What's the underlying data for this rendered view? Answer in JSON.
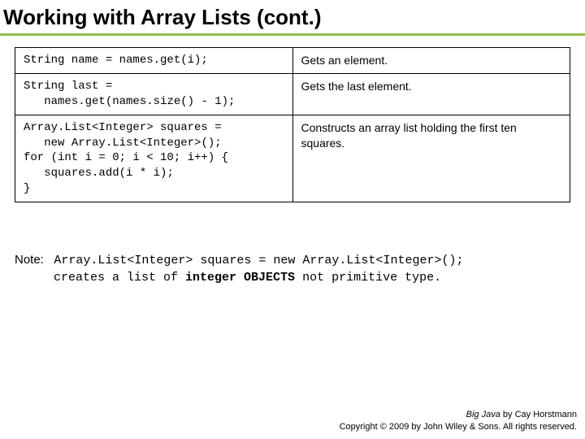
{
  "title": "Working with Array Lists (cont.)",
  "rows": [
    {
      "code": "String name = names.get(i);",
      "desc": "Gets an element."
    },
    {
      "code": "String last =\n   names.get(names.size() - 1);",
      "desc": "Gets the last element."
    },
    {
      "code": "Array.List<Integer> squares =\n   new Array.List<Integer>();\nfor (int i = 0; i < 10; i++) {\n   squares.add(i * i);\n}",
      "desc": "Constructs an array list holding the first ten squares."
    }
  ],
  "note": {
    "label": "Note:",
    "code1": "Array.List<Integer> squares = new Array.List<Integer>();",
    "line2_pre": "creates a list of ",
    "line2_bold": "integer OBJECTS",
    "line2_post": " not primitive type."
  },
  "footer": {
    "book": "Big Java",
    "by": " by Cay Horstmann",
    "copyright": "Copyright © 2009 by John Wiley & Sons. All rights reserved."
  }
}
